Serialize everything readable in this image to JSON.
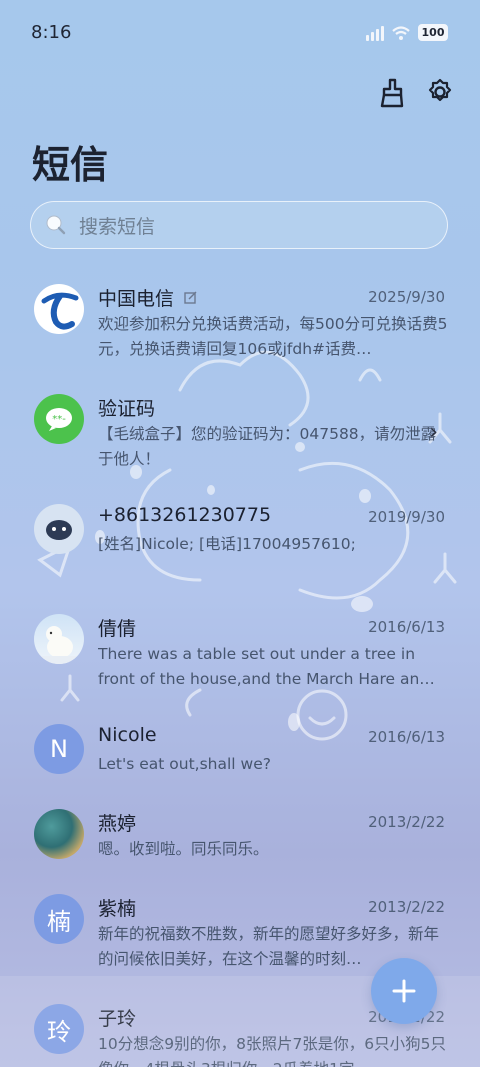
{
  "status": {
    "time": "8:16",
    "battery": "100"
  },
  "header": {
    "title": "短信"
  },
  "search": {
    "placeholder": "搜索短信"
  },
  "conversations": [
    {
      "name": "中国电信",
      "date": "2025/9/30",
      "preview": "欢迎参加积分兑换话费活动，每500分可兑换话费5元，兑换话费请回复106或jfdh#话费…",
      "avatar": "china-telecom-logo"
    },
    {
      "name": "验证码",
      "date": "",
      "preview": "【毛绒盒子】您的验证码为：047588，请勿泄露于他人！",
      "avatar": "message-bubble-icon"
    },
    {
      "name": "+8613261230775",
      "date": "2019/9/30",
      "preview": "[姓名]Nicole; [电话]17004957610;",
      "avatar": "cartoon-avatar"
    },
    {
      "name": "倩倩",
      "date": "2016/6/13",
      "preview": "There was a table set out under a tree in front of the house,and the March Hare an…",
      "avatar": "polar-bear-photo"
    },
    {
      "name": "Nicole",
      "date": "2016/6/13",
      "preview": "Let's eat out,shall we?",
      "avatar_letter": "N"
    },
    {
      "name": "燕婷",
      "date": "2013/2/22",
      "preview": "嗯。收到啦。同乐同乐。",
      "avatar": "landscape-photo"
    },
    {
      "name": "紫楠",
      "date": "2013/2/22",
      "preview": "新年的祝福数不胜数，新年的愿望好多好多，新年的问候依旧美好，在这个温馨的时刻…",
      "avatar_letter": "楠"
    },
    {
      "name": "子玲",
      "date": "2013/2/22",
      "preview": "10分想念9别的你，8张照片7张是你，6只小狗5只像你，4根骨头3根归你，2瓜着地1定…",
      "avatar_letter": "玲"
    }
  ],
  "colors": {
    "accent": "#7fa9ea",
    "letter_avatar": "#7d9be3",
    "verify_green": "#4cc24c"
  }
}
